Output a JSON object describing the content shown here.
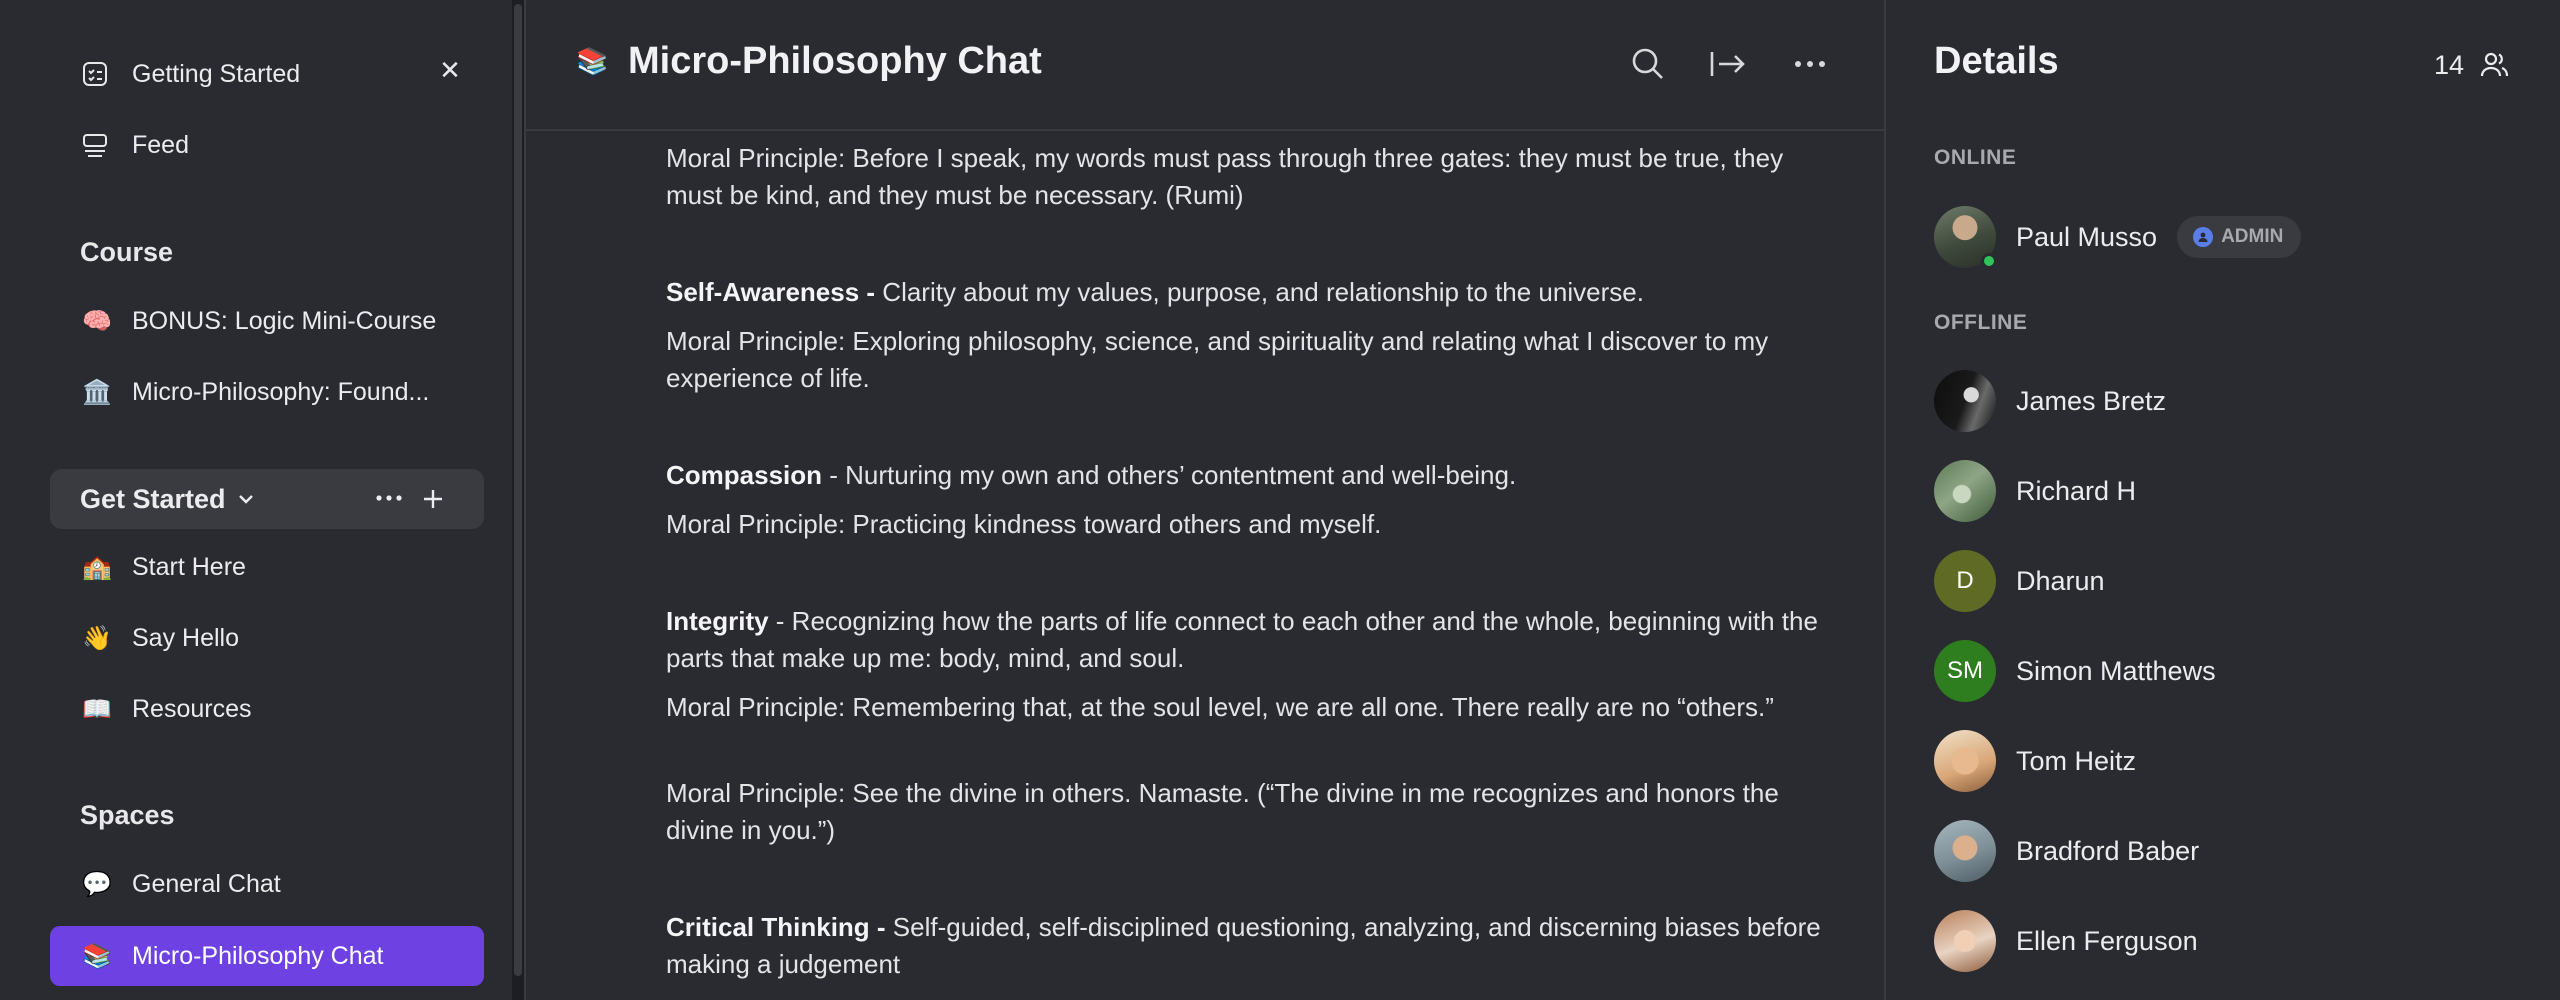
{
  "sidebar": {
    "top_items": [
      {
        "label": "Getting Started",
        "icon": "checklist-icon"
      },
      {
        "label": "Feed",
        "icon": "feed-icon"
      }
    ],
    "course": {
      "heading": "Course",
      "items": [
        {
          "label": "BONUS: Logic Mini-Course",
          "icon": "🧠"
        },
        {
          "label": "Micro-Philosophy: Found...",
          "icon": "🏛️"
        }
      ]
    },
    "group": {
      "label": "Get Started",
      "items": [
        {
          "label": "Start Here",
          "icon": "🏫"
        },
        {
          "label": "Say Hello",
          "icon": "👋"
        },
        {
          "label": "Resources",
          "icon": "📖"
        }
      ]
    },
    "spaces": {
      "heading": "Spaces",
      "items": [
        {
          "label": "General Chat",
          "icon": "💬"
        },
        {
          "label": "Micro-Philosophy Chat",
          "icon": "📚",
          "active": true
        }
      ]
    },
    "active_color": "#6e41e2"
  },
  "header": {
    "icon": "📚",
    "title": "Micro-Philosophy Chat"
  },
  "messages": {
    "p1": "Moral Principle: Before I speak, my words must pass through three gates: they must be true, they must be kind, and they must be necessary. (Rumi)",
    "p2_bold": "Self-Awareness -",
    "p2_rest": " Clarity about my values, purpose, and relationship to the universe.",
    "p3": "Moral Principle: Exploring philosophy, science, and spirituality and relating what I discover to my experience of life.",
    "p4_bold": "Compassion",
    "p4_rest": " - Nurturing my own and others’ contentment and well-being.",
    "p5": "Moral Principle: Practicing kindness toward others and myself.",
    "p6_bold": "Integrity",
    "p6_rest": " - Recognizing how the parts of life connect to each other and the whole, beginning with the parts that make up me: body, mind, and soul.",
    "p7": "Moral Principle: Remembering that, at the soul level, we are all one. There really are no “others.”",
    "p8": "Moral Principle:  See the divine in others. Namaste. (“The divine in me recognizes and honors the divine in you.”)",
    "p9_bold": "Critical Thinking -",
    "p9_rest": " Self-guided, self-disciplined questioning, analyzing, and discerning biases before making a judgement"
  },
  "details": {
    "title": "Details",
    "member_count": "14",
    "online_label": "ONLINE",
    "offline_label": "OFFLINE",
    "online": [
      {
        "name": "Paul Musso",
        "badge": "ADMIN"
      }
    ],
    "offline": [
      {
        "name": "James Bretz"
      },
      {
        "name": "Richard H"
      },
      {
        "name": "Dharun",
        "initials": "D"
      },
      {
        "name": "Simon Matthews",
        "initials": "SM"
      },
      {
        "name": "Tom Heitz"
      },
      {
        "name": "Bradford Baber"
      },
      {
        "name": "Ellen Ferguson"
      }
    ]
  }
}
